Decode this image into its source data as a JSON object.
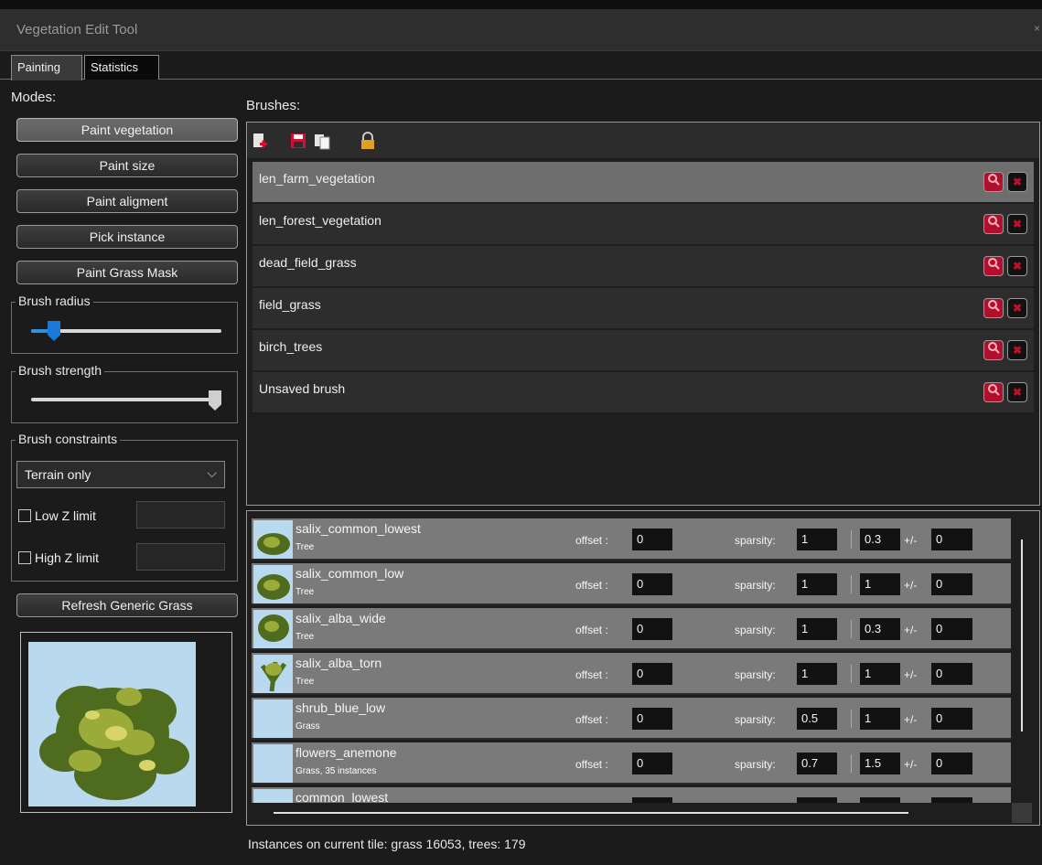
{
  "window": {
    "title": "Vegetation Edit Tool",
    "close_glyph": "×"
  },
  "tabs": [
    {
      "label": "Painting",
      "active": true
    },
    {
      "label": "Statistics",
      "active": false
    }
  ],
  "modes": {
    "label": "Modes:",
    "buttons": [
      {
        "label": "Paint vegetation",
        "active": true
      },
      {
        "label": "Paint size",
        "active": false
      },
      {
        "label": "Paint aligment",
        "active": false
      },
      {
        "label": "Pick instance",
        "active": false
      },
      {
        "label": "Paint Grass Mask",
        "active": false
      }
    ]
  },
  "brush_radius": {
    "label": "Brush radius",
    "value_fraction": 0.12
  },
  "brush_strength": {
    "label": "Brush strength",
    "value_fraction": 1.0
  },
  "constraints": {
    "label": "Brush constraints",
    "selected": "Terrain only",
    "low_z_label": "Low Z limit",
    "high_z_label": "High Z limit",
    "low_z_value": "",
    "high_z_value": ""
  },
  "refresh_button": "Refresh Generic Grass",
  "brushes": {
    "label": "Brushes:",
    "items": [
      {
        "name": "len_farm_vegetation",
        "selected": true
      },
      {
        "name": "len_forest_vegetation",
        "selected": false
      },
      {
        "name": "dead_field_grass",
        "selected": false
      },
      {
        "name": "field_grass",
        "selected": false
      },
      {
        "name": "birch_trees",
        "selected": false
      },
      {
        "name": "Unsaved brush",
        "selected": false
      }
    ]
  },
  "instance_labels": {
    "offset": "offset :",
    "sparsity": "sparsity:",
    "plusminus": "+/-"
  },
  "instances": [
    {
      "name": "salix_common_lowest",
      "type": "Tree",
      "offset": "0",
      "sparsity": "1",
      "scale": "0.3",
      "variance": "0",
      "has_image": true
    },
    {
      "name": "salix_common_low",
      "type": "Tree",
      "offset": "0",
      "sparsity": "1",
      "scale": "1",
      "variance": "0",
      "has_image": true
    },
    {
      "name": "salix_alba_wide",
      "type": "Tree",
      "offset": "0",
      "sparsity": "1",
      "scale": "0.3",
      "variance": "0",
      "has_image": true
    },
    {
      "name": "salix_alba_torn",
      "type": "Tree",
      "offset": "0",
      "sparsity": "1",
      "scale": "1",
      "variance": "0",
      "has_image": true
    },
    {
      "name": "shrub_blue_low",
      "type": "Grass",
      "offset": "0",
      "sparsity": "0.5",
      "scale": "1",
      "variance": "0",
      "has_image": false
    },
    {
      "name": "flowers_anemone",
      "type": "Grass, 35 instances",
      "offset": "0",
      "sparsity": "0.7",
      "scale": "1.5",
      "variance": "0",
      "has_image": false
    },
    {
      "name": "common_lowest",
      "type": "",
      "offset": "",
      "sparsity": "",
      "scale": "",
      "variance": "",
      "has_image": false
    }
  ],
  "status": "Instances on current tile: grass 16053, trees: 179",
  "colors": {
    "accent": "#1a78d8",
    "delete": "#c0102c",
    "magnify": "#b0102c"
  }
}
